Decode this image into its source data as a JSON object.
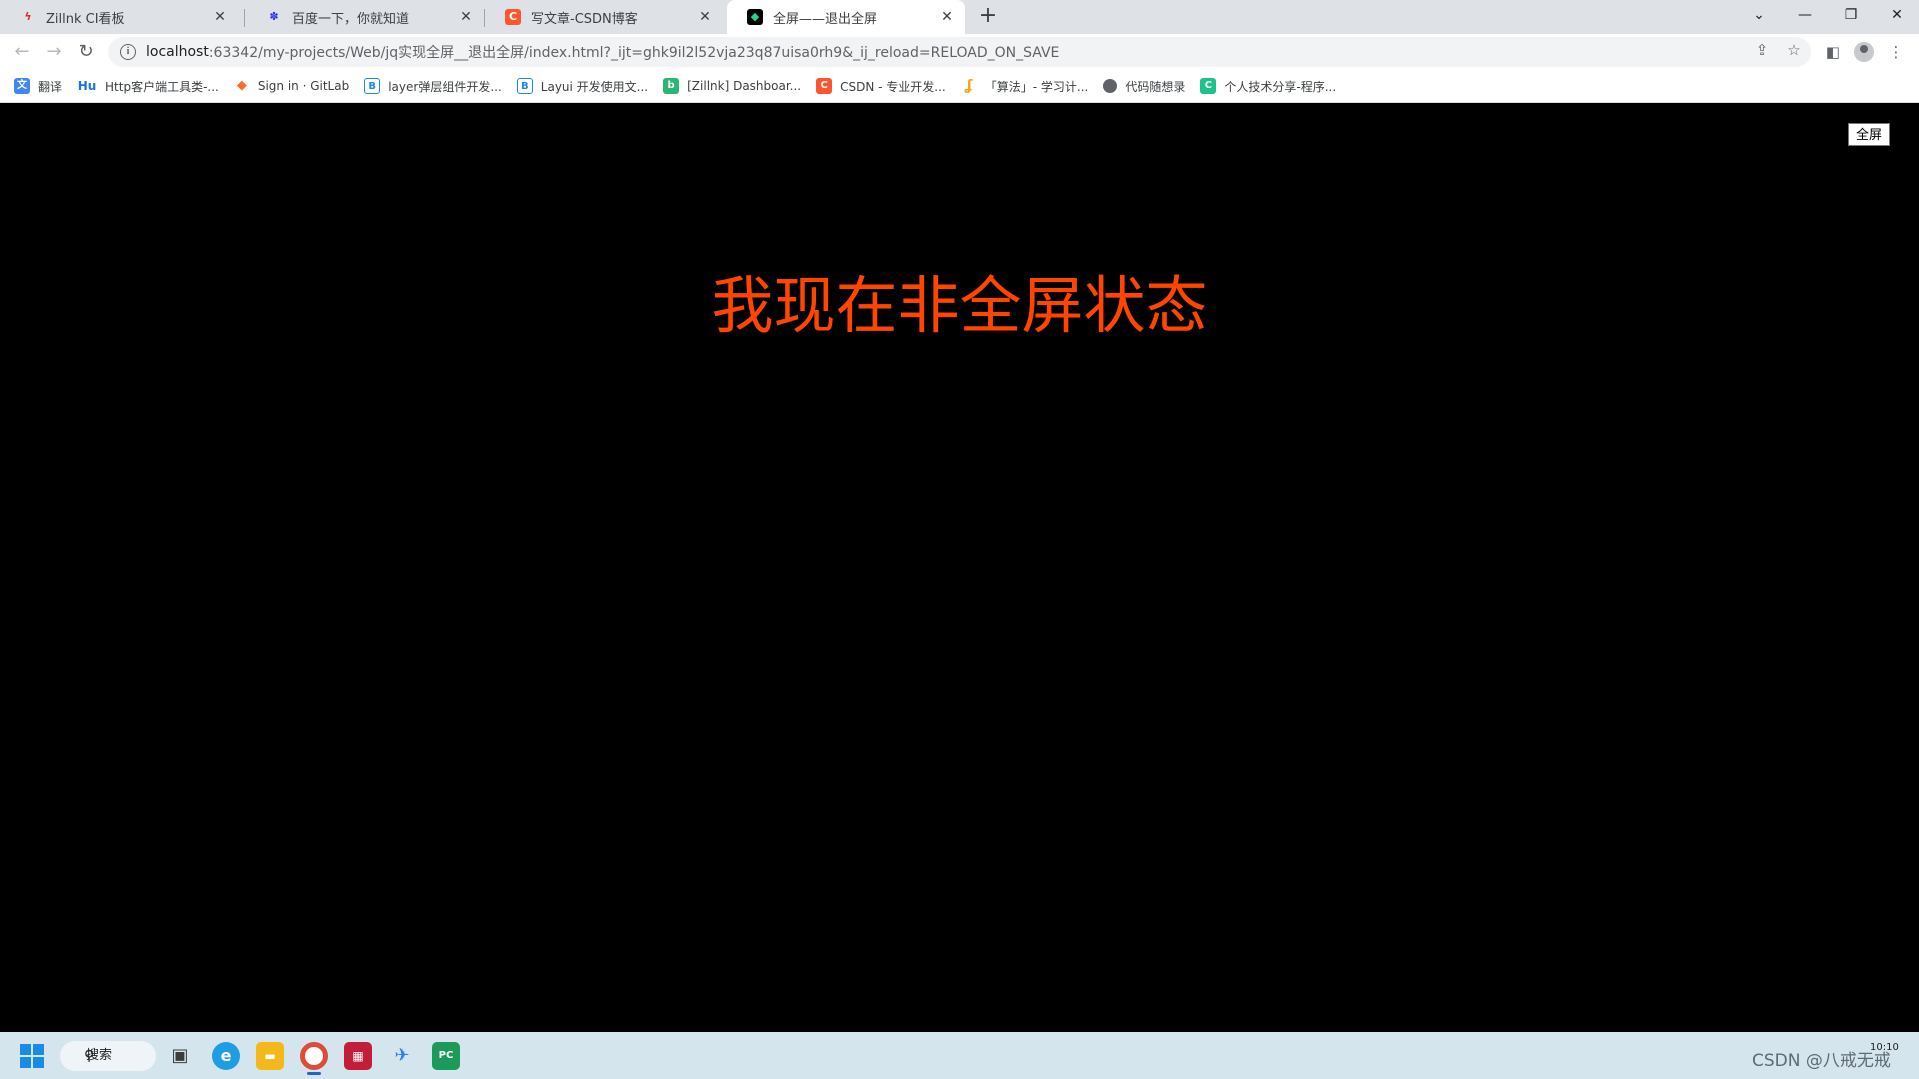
{
  "browser": {
    "tabs": [
      {
        "title": "Zillnk CI看板",
        "favicon": "zillnk-icon",
        "color": "#d93025",
        "active": false
      },
      {
        "title": "百度一下，你就知道",
        "favicon": "baidu-icon",
        "color": "#2932e1",
        "active": false
      },
      {
        "title": "写文章-CSDN博客",
        "favicon": "csdn-icon",
        "color": "#fc5531",
        "active": false
      },
      {
        "title": "全屏——退出全屏",
        "favicon": "pycharm-icon",
        "color": "#21d789",
        "active": true
      }
    ],
    "new_tab_symbol": "+",
    "address": {
      "host": "localhost",
      "rest": ":63342/my-projects/Web/jq实现全屏__退出全屏/index.html?_ijt=ghk9il2l52vja23q87uisa0rh9&_ij_reload=RELOAD_ON_SAVE"
    },
    "bookmarks": [
      {
        "label": "翻译",
        "icon": "translate-icon",
        "color": "#4285f4",
        "glyph": "文"
      },
      {
        "label": "Http客户端工具类-...",
        "icon": "hu-icon",
        "color": "#1a73e8",
        "glyph": "Hu"
      },
      {
        "label": "Sign in · GitLab",
        "icon": "gitlab-icon",
        "color": "#fc6d26",
        "glyph": "◆"
      },
      {
        "label": "layer弹层组件开发...",
        "icon": "layer-icon",
        "color": "#1e88e5",
        "glyph": "B"
      },
      {
        "label": "Layui 开发使用文...",
        "icon": "layui-icon",
        "color": "#1e88e5",
        "glyph": "B"
      },
      {
        "label": "[Zillnk] Dashboar...",
        "icon": "zillnk-dashboard-icon",
        "color": "#2bb673",
        "glyph": "b"
      },
      {
        "label": "CSDN - 专业开发...",
        "icon": "csdn-icon",
        "color": "#fc5531",
        "glyph": "C"
      },
      {
        "label": "「算法」- 学习计...",
        "icon": "leetcode-icon",
        "color": "#ffa116",
        "glyph": "ʆ"
      },
      {
        "label": "代码随想录",
        "icon": "globe-icon",
        "color": "#5f6368",
        "glyph": "●"
      },
      {
        "label": "个人技术分享-程序...",
        "icon": "c-icon",
        "color": "#1ec28b",
        "glyph": "C"
      }
    ]
  },
  "page": {
    "fullscreen_button": "全屏",
    "status_text": "我现在非全屏状态",
    "status_color": "#ff4500"
  },
  "taskbar": {
    "search_label": "搜索",
    "clock": "10:10",
    "watermark": "CSDN @八戒无戒",
    "apps": [
      {
        "name": "task-view-icon",
        "color": "#3c3c3c",
        "glyph": "▣"
      },
      {
        "name": "edge-icon",
        "color": "#1f9de0",
        "glyph": "e"
      },
      {
        "name": "file-explorer-icon",
        "color": "#f3b91c",
        "glyph": "▬"
      },
      {
        "name": "chrome-icon",
        "color": "#dd4b39",
        "glyph": "◉"
      },
      {
        "name": "jetbrains-icon",
        "color": "#c21e3a",
        "glyph": "▦"
      },
      {
        "name": "feishu-icon",
        "color": "#2f7cf6",
        "glyph": "✈"
      },
      {
        "name": "pycharm-icon",
        "color": "#1b9a59",
        "glyph": "PC"
      }
    ]
  }
}
